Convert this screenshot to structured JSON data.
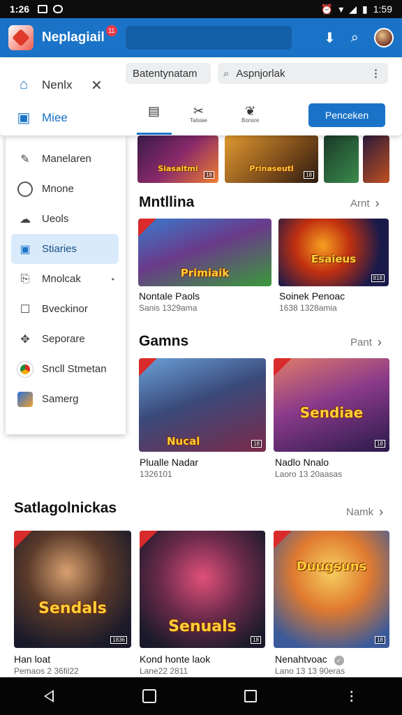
{
  "status_bar": {
    "time": "1:26",
    "battery": "1:59"
  },
  "app_bar": {
    "title": "Neplagiail",
    "badge": "11",
    "search_placeholder": ""
  },
  "panel": {
    "items": [
      {
        "label": "Nenlx"
      },
      {
        "label": "Miee"
      }
    ],
    "field_one": "Batentynatam",
    "search": "Aspnjorlak",
    "tabs": [
      {
        "label": ""
      },
      {
        "label": "Talsiae"
      },
      {
        "label": "Bonsre"
      }
    ],
    "button": "Penceken"
  },
  "drawer": {
    "items": [
      {
        "label": "Manelaren",
        "icon": "puzzle-icon"
      },
      {
        "label": "Mnone",
        "icon": "coin-icon"
      },
      {
        "label": "Ueols",
        "icon": "cloud-icon"
      },
      {
        "label": "Stiaries",
        "icon": "square-icon"
      },
      {
        "label": "Mnolcak",
        "icon": "tray-icon"
      },
      {
        "label": "Bveckinor",
        "icon": "box-icon"
      },
      {
        "label": "Seporare",
        "icon": "puzzle-icon"
      },
      {
        "label": "Sncll Stmetan",
        "icon": "chrome-icon"
      },
      {
        "label": "Samerg",
        "icon": "app-icon"
      }
    ]
  },
  "top_strip": [
    {
      "label": "Siasaitmi",
      "rating": "18"
    },
    {
      "label": "Prinaseutl",
      "rating": "18"
    },
    {
      "label": ""
    },
    {
      "label": ""
    }
  ],
  "sections": [
    {
      "title": "Mntllina",
      "more": "Arnt",
      "cards": [
        {
          "art": "Primiaik",
          "rating": "",
          "title": "Nontale Paols",
          "subtitle": "Sanis 1329ama"
        },
        {
          "art": "Esaieus",
          "rating": "818",
          "title": "Soinek Penoac",
          "subtitle": "1638 1328amia"
        }
      ]
    },
    {
      "title": "Gamns",
      "more": "Pant",
      "cards": [
        {
          "art": "Nucal",
          "rating": "18",
          "title": "Plualle Nadar",
          "subtitle": "1326101"
        },
        {
          "art": "Sendiae",
          "rating": "18",
          "title": "Nadlo Nnalo",
          "subtitle": "Laoro 13 20aasas"
        }
      ]
    },
    {
      "title": "Satlagolnickas",
      "more": "Namk",
      "cards": [
        {
          "art": "Sendals",
          "rating": "1836",
          "title": "Han loat",
          "subtitle": "Pemaos 2 36fil22"
        },
        {
          "art": "Senuals",
          "rating": "18",
          "title": "Kond honte laok",
          "subtitle": "Lane22 2811"
        },
        {
          "art": "Duugsuns",
          "rating": "18",
          "title": "Nenahtvoac",
          "subtitle": "Lano 13 13 90eras"
        }
      ]
    }
  ],
  "colors": {
    "primary": "#1a73c7",
    "badge": "#e8394a",
    "drawer_active": "#d9ebfa"
  }
}
